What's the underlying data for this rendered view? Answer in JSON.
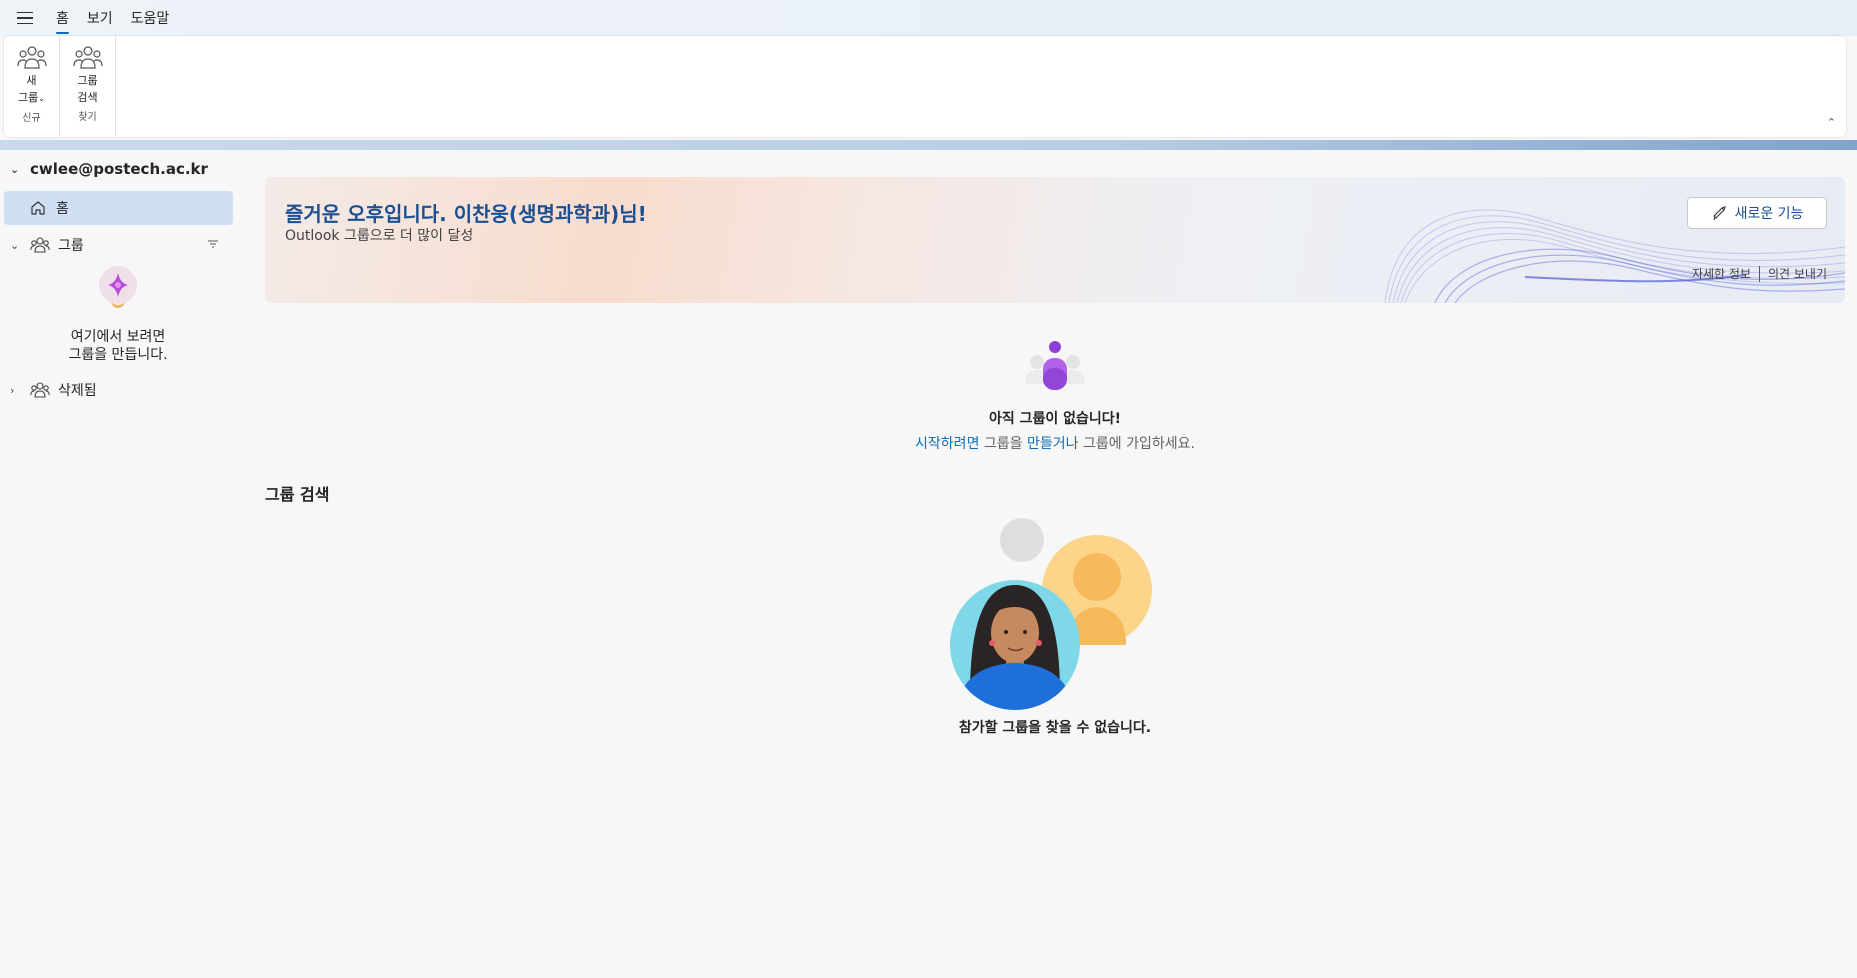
{
  "menu": {
    "tabs": [
      {
        "label": "홈"
      },
      {
        "label": "보기"
      },
      {
        "label": "도움말"
      }
    ]
  },
  "ribbon": {
    "new_group": {
      "line1": "새",
      "line2": "그룹",
      "group_label": "신규"
    },
    "find_group": {
      "line1": "그룹",
      "line2": "검색",
      "group_label": "찾기"
    }
  },
  "sidebar": {
    "account": "cwlee@postech.ac.kr",
    "home": "홈",
    "groups": "그룹",
    "empty_text_line1": "여기에서 보려면",
    "empty_text_line2": "그룹을 만듭니다.",
    "deleted": "삭제됨"
  },
  "banner": {
    "title": "즐거운 오후입니다. 이찬웅(생명과학과)님!",
    "subtitle": "Outlook 그룹으로 더 많이 달성",
    "new_features_button": "새로운 기능",
    "learn_more": "자세한 정보",
    "feedback": "의견 보내기"
  },
  "empty_groups": {
    "title": "아직 그룹이 없습니다!",
    "link_start": "시작하려면",
    "text_group": "그룹을",
    "link_create": "만들거나",
    "text_join": "그룹에 가입하세요."
  },
  "discover": {
    "title": "그룹 검색",
    "caption": "참가할 그룹을 찾을 수 없습니다."
  },
  "colors": {
    "accent": "#0f6cbd",
    "banner_title": "#1b4f91",
    "nav_selected": "#d0e0f4"
  }
}
